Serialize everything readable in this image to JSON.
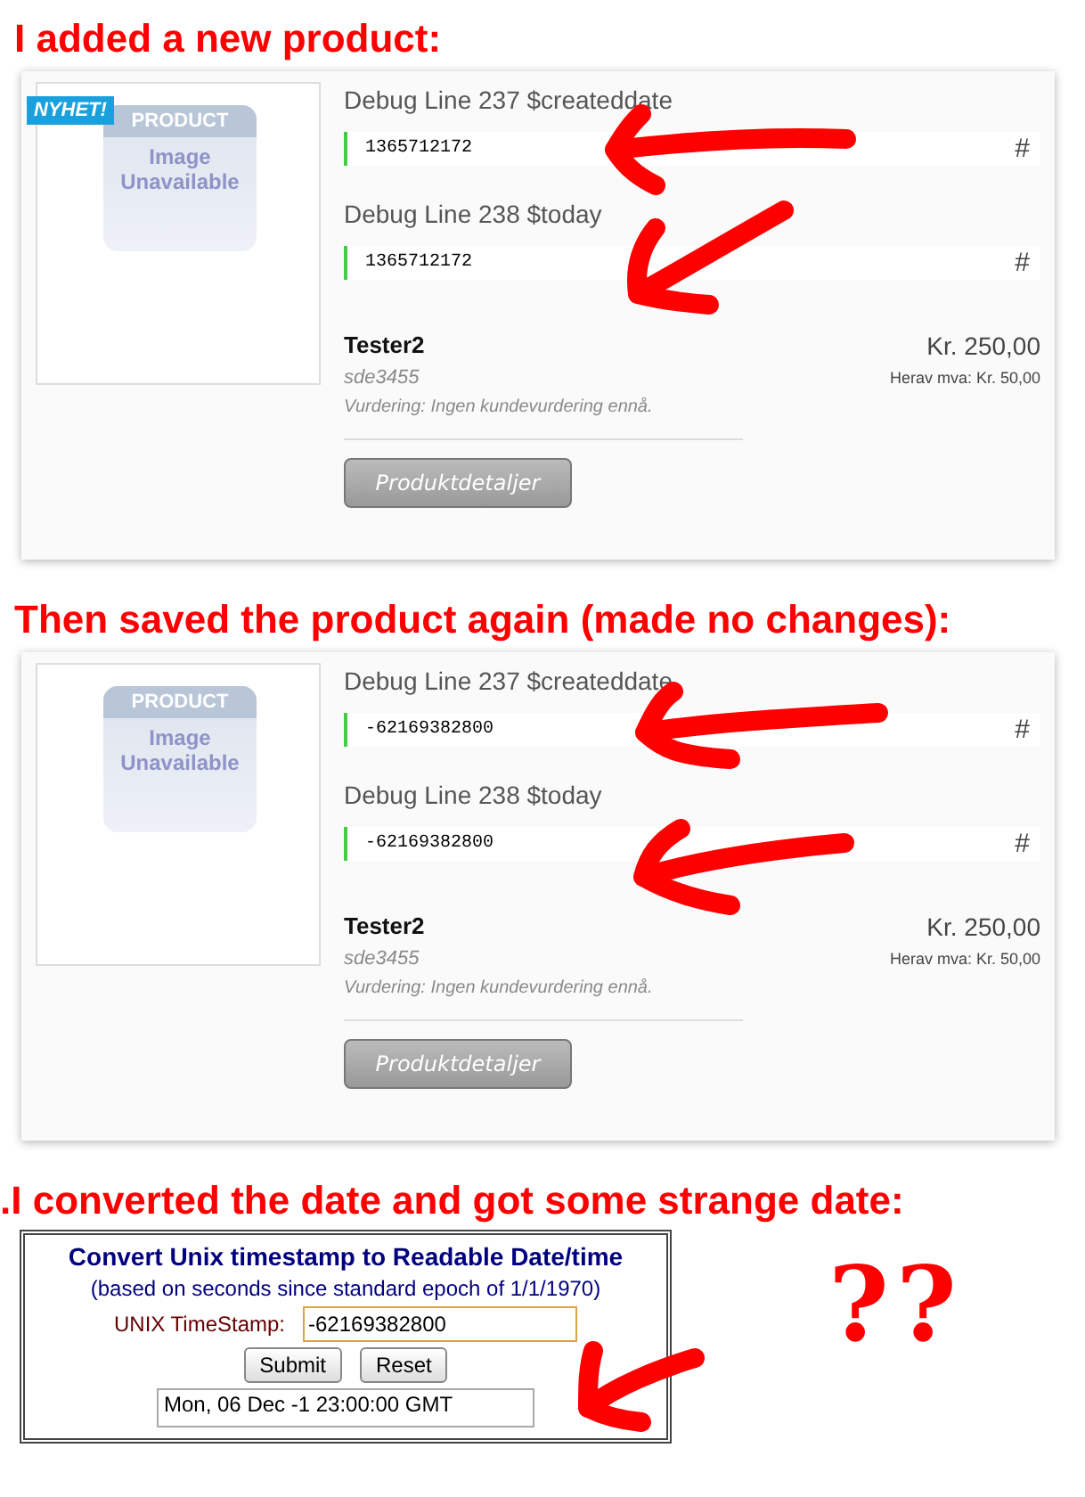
{
  "sections": [
    {
      "caption": "I added a new product:",
      "product": {
        "badge": "NYHET!",
        "image_label": "PRODUCT",
        "image_text": "Image Unavailable",
        "debug_lines": [
          {
            "label": "Debug Line 237 $createddate",
            "value": "1365712172",
            "hash": "#"
          },
          {
            "label": "Debug Line 238 $today",
            "value": "1365712172",
            "hash": "#"
          }
        ],
        "name": "Tester2",
        "sku": "sde3455",
        "rating": "Vurdering: Ingen kundevurdering ennå.",
        "price": "Kr. 250,00",
        "vat": "Herav mva: Kr. 50,00",
        "button": "Produktdetaljer"
      }
    },
    {
      "caption": "Then saved the product again (made no changes):",
      "product": {
        "image_label": "PRODUCT",
        "image_text": "Image Unavailable",
        "debug_lines": [
          {
            "label": "Debug Line 237 $createddate",
            "value": "-62169382800",
            "hash": "#"
          },
          {
            "label": "Debug Line 238 $today",
            "value": "-62169382800",
            "hash": "#"
          }
        ],
        "name": "Tester2",
        "sku": "sde3455",
        "rating": "Vurdering: Ingen kundevurdering ennå.",
        "price": "Kr. 250,00",
        "vat": "Herav mva: Kr. 50,00",
        "button": "Produktdetaljer"
      }
    }
  ],
  "converter": {
    "caption": ".I converted the date and got some strange date:",
    "title": "Convert Unix timestamp to Readable Date/time",
    "subtitle": "(based on seconds since standard epoch of 1/1/1970)",
    "field_label": "UNIX TimeStamp:",
    "field_value": "-62169382800",
    "buttons": [
      "Submit",
      "Reset"
    ],
    "result": "Mon, 06 Dec -1 23:00:00 GMT"
  },
  "scribble": "??"
}
